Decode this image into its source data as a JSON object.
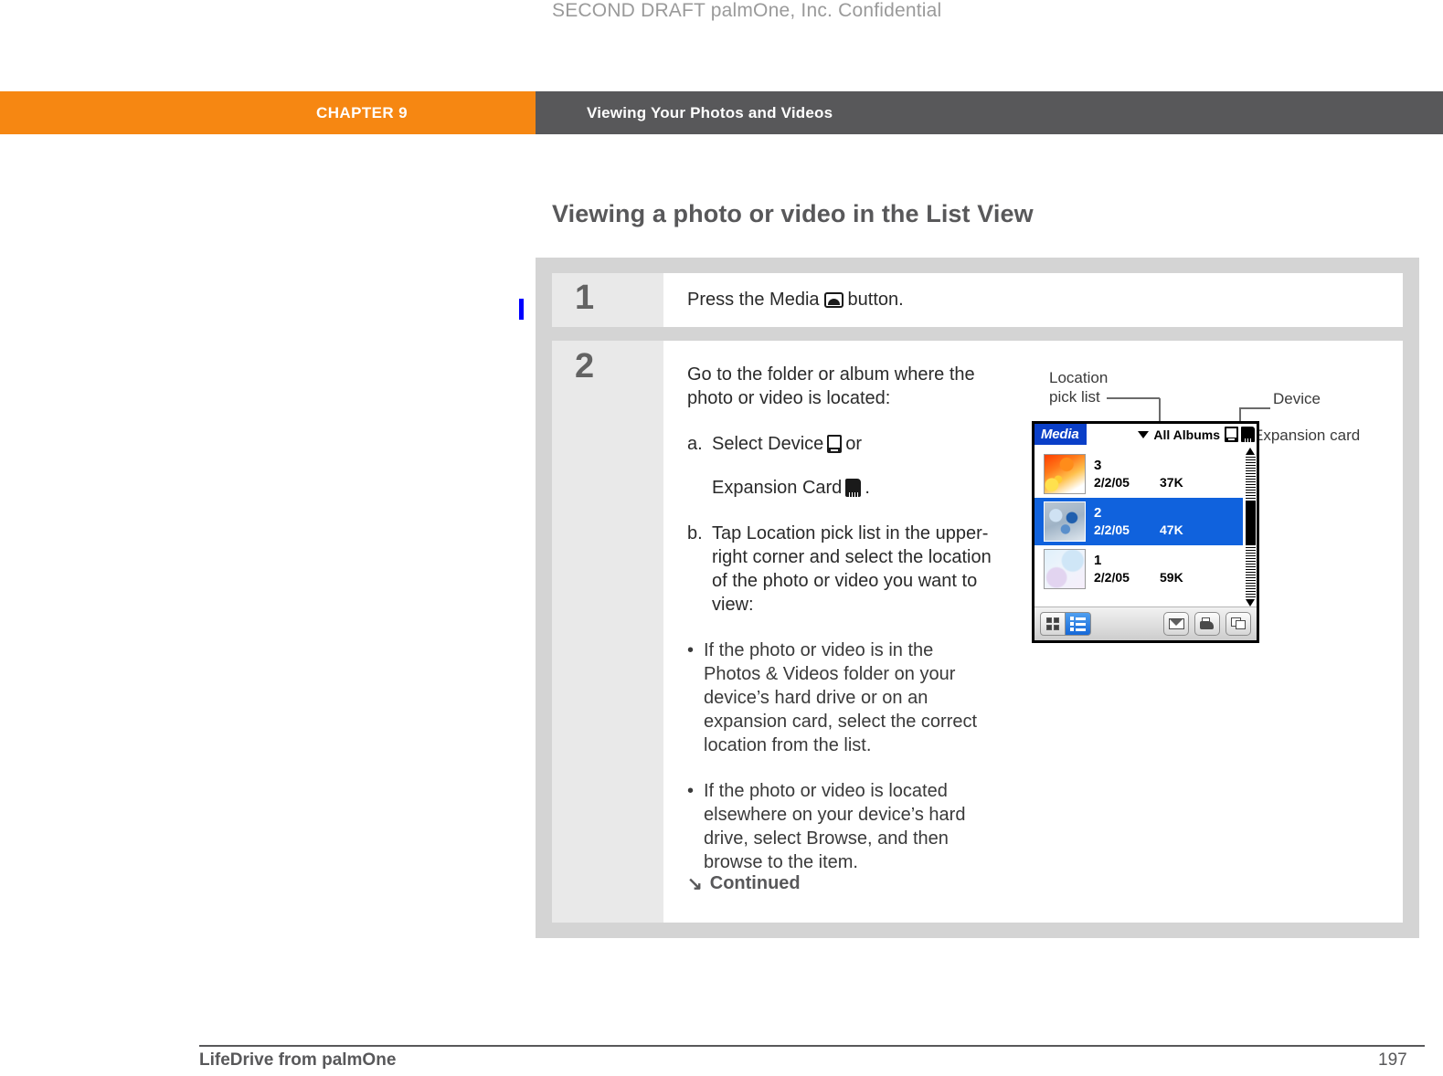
{
  "draft_notice": "SECOND DRAFT palmOne, Inc.  Confidential",
  "header": {
    "chapter_label": "CHAPTER 9",
    "chapter_title": "Viewing Your Photos and Videos",
    "chapter_bg": "#f68712",
    "title_bg": "#58585a"
  },
  "section": {
    "heading": "Viewing a photo or video in the List View"
  },
  "steps": [
    {
      "number": "1",
      "text_before_icon": "Press the Media",
      "icon": "media-icon",
      "text_after_icon": "button."
    },
    {
      "number": "2",
      "intro": "Go to the folder or album where the photo or video is located:",
      "sub_a": {
        "marker": "a.",
        "line1_text": "Select Device",
        "line1_icon": "device-icon",
        "line1_tail": "or",
        "line2_text": "Expansion Card",
        "line2_icon": "expansion-card-icon",
        "line2_tail": "."
      },
      "sub_b": {
        "marker": "b.",
        "text": "Tap Location pick list in the upper-right corner and select the location of the photo or video you want to view:"
      },
      "bullets": [
        "If the photo or video is in the Photos & Videos folder on your device’s hard drive or on an expansion card, select the correct location from the list.",
        "If the photo or video is located elsewhere on your device’s hard drive, select Browse, and then browse to the item."
      ],
      "continued_label": "Continued",
      "continued_arrow": "↘"
    }
  ],
  "callouts": {
    "location_pick_list": "Location\npick list",
    "location_line1": "Location",
    "location_line2": "pick list",
    "device": "Device",
    "expansion_card": "Expansion card"
  },
  "pda": {
    "app_name": "Media",
    "pick_list_value": "All Albums",
    "title_icons": [
      "device-icon",
      "expansion-card-icon"
    ],
    "columns": [
      "name",
      "date",
      "size"
    ],
    "items": [
      {
        "name": "3",
        "date": "2/2/05",
        "size": "37K",
        "selected": false
      },
      {
        "name": "2",
        "date": "2/2/05",
        "size": "47K",
        "selected": true
      },
      {
        "name": "1",
        "date": "2/2/05",
        "size": "59K",
        "selected": false
      }
    ],
    "toolbar": {
      "thumbnail_view": "grid-view-icon",
      "list_view": "list-view-icon",
      "send": "envelope-icon",
      "print": "printer-icon",
      "copy": "copy-icon"
    },
    "selection_color": "#1062dd",
    "titlebar_color": "#0a3fc8"
  },
  "footer": {
    "left": "LifeDrive from palmOne",
    "page_number": "197"
  }
}
